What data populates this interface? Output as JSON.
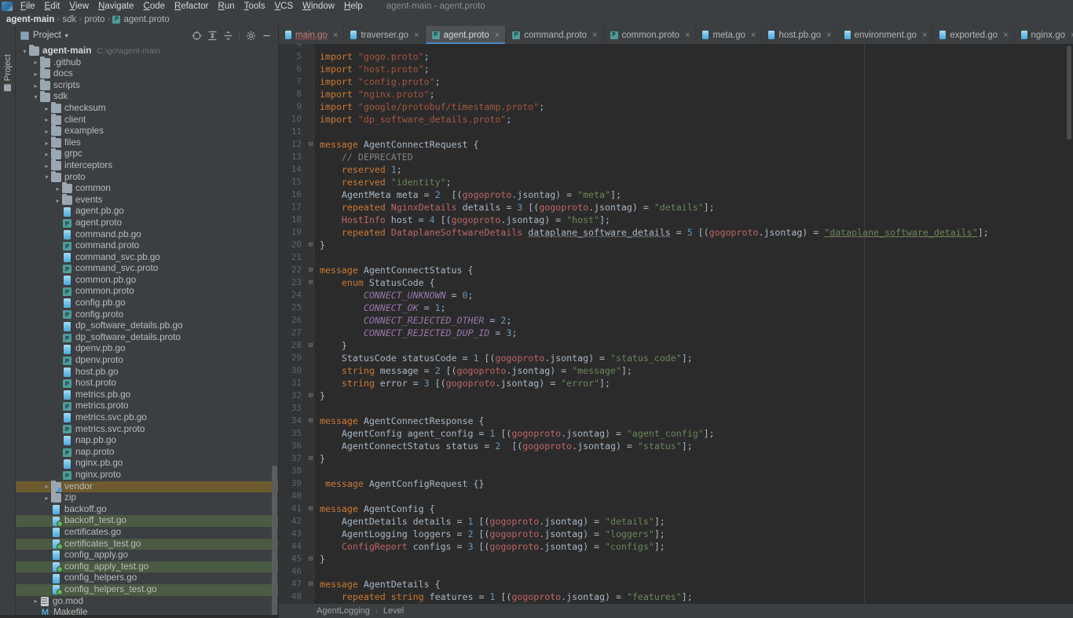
{
  "window": {
    "title": "agent-main - agent.proto",
    "app_icon": "intellij-idea-icon"
  },
  "menubar": {
    "items": [
      "File",
      "Edit",
      "View",
      "Navigate",
      "Code",
      "Refactor",
      "Run",
      "Tools",
      "VCS",
      "Window",
      "Help"
    ]
  },
  "breadcrumb": {
    "items": [
      "agent-main",
      "sdk",
      "proto",
      "agent.proto"
    ],
    "separator": "›"
  },
  "toolstrip": {
    "project_label": "Project"
  },
  "project_panel": {
    "title": "Project",
    "caret": "▾",
    "tools": [
      {
        "name": "locate-icon",
        "glyph": "⊕"
      },
      {
        "name": "expand-all-icon",
        "glyph": "⨏"
      },
      {
        "name": "collapse-all-icon",
        "glyph": "⊖"
      },
      {
        "name": "gear-icon",
        "glyph": "⚙"
      },
      {
        "name": "hide-panel-icon",
        "glyph": "—"
      }
    ],
    "tree": [
      {
        "label": "agent-main",
        "sub": "C:\\go\\agent-main",
        "indent": 0,
        "arrow": "v",
        "icon": "folder",
        "bold": true,
        "hl": ""
      },
      {
        "label": ".github",
        "sub": "",
        "indent": 1,
        "arrow": ">",
        "icon": "folder",
        "bold": false,
        "hl": ""
      },
      {
        "label": "docs",
        "sub": "",
        "indent": 1,
        "arrow": ">",
        "icon": "folder",
        "bold": false,
        "hl": ""
      },
      {
        "label": "scripts",
        "sub": "",
        "indent": 1,
        "arrow": ">",
        "icon": "folder",
        "bold": false,
        "hl": ""
      },
      {
        "label": "sdk",
        "sub": "",
        "indent": 1,
        "arrow": "v",
        "icon": "folder",
        "bold": false,
        "hl": ""
      },
      {
        "label": "checksum",
        "sub": "",
        "indent": 2,
        "arrow": ">",
        "icon": "folder",
        "bold": false,
        "hl": ""
      },
      {
        "label": "client",
        "sub": "",
        "indent": 2,
        "arrow": ">",
        "icon": "folder",
        "bold": false,
        "hl": ""
      },
      {
        "label": "examples",
        "sub": "",
        "indent": 2,
        "arrow": ">",
        "icon": "folder",
        "bold": false,
        "hl": ""
      },
      {
        "label": "files",
        "sub": "",
        "indent": 2,
        "arrow": ">",
        "icon": "folder",
        "bold": false,
        "hl": ""
      },
      {
        "label": "grpc",
        "sub": "",
        "indent": 2,
        "arrow": ">",
        "icon": "folder",
        "bold": false,
        "hl": ""
      },
      {
        "label": "interceptors",
        "sub": "",
        "indent": 2,
        "arrow": ">",
        "icon": "folder",
        "bold": false,
        "hl": ""
      },
      {
        "label": "proto",
        "sub": "",
        "indent": 2,
        "arrow": "v",
        "icon": "folder",
        "bold": false,
        "hl": ""
      },
      {
        "label": "common",
        "sub": "",
        "indent": 3,
        "arrow": ">",
        "icon": "folder",
        "bold": false,
        "hl": ""
      },
      {
        "label": "events",
        "sub": "",
        "indent": 3,
        "arrow": ">",
        "icon": "folder",
        "bold": false,
        "hl": ""
      },
      {
        "label": "agent.pb.go",
        "sub": "",
        "indent": 3,
        "arrow": "",
        "icon": "go",
        "bold": false,
        "hl": ""
      },
      {
        "label": "agent.proto",
        "sub": "",
        "indent": 3,
        "arrow": "",
        "icon": "proto",
        "bold": false,
        "hl": ""
      },
      {
        "label": "command.pb.go",
        "sub": "",
        "indent": 3,
        "arrow": "",
        "icon": "go",
        "bold": false,
        "hl": ""
      },
      {
        "label": "command.proto",
        "sub": "",
        "indent": 3,
        "arrow": "",
        "icon": "proto",
        "bold": false,
        "hl": ""
      },
      {
        "label": "command_svc.pb.go",
        "sub": "",
        "indent": 3,
        "arrow": "",
        "icon": "go",
        "bold": false,
        "hl": ""
      },
      {
        "label": "command_svc.proto",
        "sub": "",
        "indent": 3,
        "arrow": "",
        "icon": "proto",
        "bold": false,
        "hl": ""
      },
      {
        "label": "common.pb.go",
        "sub": "",
        "indent": 3,
        "arrow": "",
        "icon": "go",
        "bold": false,
        "hl": ""
      },
      {
        "label": "common.proto",
        "sub": "",
        "indent": 3,
        "arrow": "",
        "icon": "proto",
        "bold": false,
        "hl": ""
      },
      {
        "label": "config.pb.go",
        "sub": "",
        "indent": 3,
        "arrow": "",
        "icon": "go",
        "bold": false,
        "hl": ""
      },
      {
        "label": "config.proto",
        "sub": "",
        "indent": 3,
        "arrow": "",
        "icon": "proto",
        "bold": false,
        "hl": ""
      },
      {
        "label": "dp_software_details.pb.go",
        "sub": "",
        "indent": 3,
        "arrow": "",
        "icon": "go",
        "bold": false,
        "hl": ""
      },
      {
        "label": "dp_software_details.proto",
        "sub": "",
        "indent": 3,
        "arrow": "",
        "icon": "proto",
        "bold": false,
        "hl": ""
      },
      {
        "label": "dpenv.pb.go",
        "sub": "",
        "indent": 3,
        "arrow": "",
        "icon": "go",
        "bold": false,
        "hl": ""
      },
      {
        "label": "dpenv.proto",
        "sub": "",
        "indent": 3,
        "arrow": "",
        "icon": "proto",
        "bold": false,
        "hl": ""
      },
      {
        "label": "host.pb.go",
        "sub": "",
        "indent": 3,
        "arrow": "",
        "icon": "go",
        "bold": false,
        "hl": ""
      },
      {
        "label": "host.proto",
        "sub": "",
        "indent": 3,
        "arrow": "",
        "icon": "proto",
        "bold": false,
        "hl": ""
      },
      {
        "label": "metrics.pb.go",
        "sub": "",
        "indent": 3,
        "arrow": "",
        "icon": "go",
        "bold": false,
        "hl": ""
      },
      {
        "label": "metrics.proto",
        "sub": "",
        "indent": 3,
        "arrow": "",
        "icon": "proto",
        "bold": false,
        "hl": ""
      },
      {
        "label": "metrics.svc.pb.go",
        "sub": "",
        "indent": 3,
        "arrow": "",
        "icon": "go",
        "bold": false,
        "hl": ""
      },
      {
        "label": "metrics.svc.proto",
        "sub": "",
        "indent": 3,
        "arrow": "",
        "icon": "proto",
        "bold": false,
        "hl": ""
      },
      {
        "label": "nap.pb.go",
        "sub": "",
        "indent": 3,
        "arrow": "",
        "icon": "go",
        "bold": false,
        "hl": ""
      },
      {
        "label": "nap.proto",
        "sub": "",
        "indent": 3,
        "arrow": "",
        "icon": "proto",
        "bold": false,
        "hl": ""
      },
      {
        "label": "nginx.pb.go",
        "sub": "",
        "indent": 3,
        "arrow": "",
        "icon": "go",
        "bold": false,
        "hl": ""
      },
      {
        "label": "nginx.proto",
        "sub": "",
        "indent": 3,
        "arrow": "",
        "icon": "proto",
        "bold": false,
        "hl": ""
      },
      {
        "label": "vendor",
        "sub": "",
        "indent": 2,
        "arrow": ">",
        "icon": "folder-mod",
        "bold": false,
        "hl": "olive"
      },
      {
        "label": "zip",
        "sub": "",
        "indent": 2,
        "arrow": ">",
        "icon": "folder",
        "bold": false,
        "hl": ""
      },
      {
        "label": "backoff.go",
        "sub": "",
        "indent": 2,
        "arrow": "",
        "icon": "go",
        "bold": false,
        "hl": ""
      },
      {
        "label": "backoff_test.go",
        "sub": "",
        "indent": 2,
        "arrow": "",
        "icon": "gotest",
        "bold": false,
        "hl": "green"
      },
      {
        "label": "certificates.go",
        "sub": "",
        "indent": 2,
        "arrow": "",
        "icon": "go",
        "bold": false,
        "hl": ""
      },
      {
        "label": "certificates_test.go",
        "sub": "",
        "indent": 2,
        "arrow": "",
        "icon": "gotest",
        "bold": false,
        "hl": "green"
      },
      {
        "label": "config_apply.go",
        "sub": "",
        "indent": 2,
        "arrow": "",
        "icon": "go",
        "bold": false,
        "hl": ""
      },
      {
        "label": "config_apply_test.go",
        "sub": "",
        "indent": 2,
        "arrow": "",
        "icon": "gotest",
        "bold": false,
        "hl": "green"
      },
      {
        "label": "config_helpers.go",
        "sub": "",
        "indent": 2,
        "arrow": "",
        "icon": "go",
        "bold": false,
        "hl": ""
      },
      {
        "label": "config_helpers_test.go",
        "sub": "",
        "indent": 2,
        "arrow": "",
        "icon": "gotest",
        "bold": false,
        "hl": "green"
      },
      {
        "label": "go.mod",
        "sub": "",
        "indent": 1,
        "arrow": ">",
        "icon": "gomod",
        "bold": false,
        "hl": ""
      },
      {
        "label": "Makefile",
        "sub": "",
        "indent": 1,
        "arrow": "",
        "icon": "makefile",
        "bold": false,
        "hl": ""
      }
    ]
  },
  "editor": {
    "tabs": [
      {
        "label": "main.go",
        "icon": "go",
        "active": false,
        "error": true
      },
      {
        "label": "traverser.go",
        "icon": "go",
        "active": false,
        "error": false
      },
      {
        "label": "agent.proto",
        "icon": "proto",
        "active": true,
        "error": false
      },
      {
        "label": "command.proto",
        "icon": "proto",
        "active": false,
        "error": false
      },
      {
        "label": "common.proto",
        "icon": "proto",
        "active": false,
        "error": false
      },
      {
        "label": "meta.go",
        "icon": "go",
        "active": false,
        "error": false
      },
      {
        "label": "host.pb.go",
        "icon": "go",
        "active": false,
        "error": false
      },
      {
        "label": "environment.go",
        "icon": "go",
        "active": false,
        "error": false
      },
      {
        "label": "exported.go",
        "icon": "go",
        "active": false,
        "error": false
      },
      {
        "label": "nginx.go",
        "icon": "go",
        "active": false,
        "error": false
      }
    ],
    "close_glyph": "×",
    "first_line_number": 4,
    "lines": [
      {
        "n": 4,
        "fold": "",
        "html": ""
      },
      {
        "n": 5,
        "fold": "",
        "html": "<span class='k'>import</span> <span class='istr'>\"gogo.proto\"</span>;"
      },
      {
        "n": 6,
        "fold": "",
        "html": "<span class='k'>import</span> <span class='istr'>\"host.proto\"</span>;"
      },
      {
        "n": 7,
        "fold": "",
        "html": "<span class='k'>import</span> <span class='istr'>\"config.proto\"</span>;"
      },
      {
        "n": 8,
        "fold": "",
        "html": "<span class='k'>import</span> <span class='istr'>\"nginx.proto\"</span>;"
      },
      {
        "n": 9,
        "fold": "",
        "html": "<span class='k'>import</span> <span class='istr'>\"google/protobuf/timestamp.proto\"</span>;"
      },
      {
        "n": 10,
        "fold": "",
        "html": "<span class='k'>import</span> <span class='istr'>\"dp_software_details.proto\"</span>;"
      },
      {
        "n": 11,
        "fold": "",
        "html": ""
      },
      {
        "n": 12,
        "fold": "-",
        "html": "<span class='k'>message</span> AgentConnectRequest {"
      },
      {
        "n": 13,
        "fold": "",
        "html": "    <span class='cmt'>// DEPRECATED</span>"
      },
      {
        "n": 14,
        "fold": "",
        "html": "    <span class='k'>reserved</span> <span class='num2'>1</span>;"
      },
      {
        "n": 15,
        "fold": "",
        "html": "    <span class='k'>reserved</span> <span class='str'>\"identity\"</span>;"
      },
      {
        "n": 16,
        "fold": "",
        "html": "    <span class='typ'>AgentMeta</span> meta = <span class='num2'>2</span>  [(<span class='optr'>gogoproto</span>.jsontag) = <span class='str'>\"meta\"</span>];"
      },
      {
        "n": 17,
        "fold": "",
        "html": "    <span class='k'>repeated</span> <span class='ctyp'>NginxDetails</span> details = <span class='num2'>3</span> [(<span class='optr'>gogoproto</span>.jsontag) = <span class='str'>\"details\"</span>];"
      },
      {
        "n": 18,
        "fold": "",
        "html": "    <span class='ctyp'>HostInfo</span> host = <span class='num2'>4</span> [(<span class='optr'>gogoproto</span>.jsontag) = <span class='str'>\"host\"</span>];"
      },
      {
        "n": 19,
        "fold": "",
        "html": "    <span class='k'>repeated</span> <span class='ctyp'>DataplaneSoftwareDetails</span> <span class='undw'>dataplane_software_details</span> = <span class='num2'>5</span> [(<span class='optr'>gogoproto</span>.jsontag) = <span class='str und'>\"dataplane_software_details\"</span>];"
      },
      {
        "n": 20,
        "fold": "-",
        "html": "}"
      },
      {
        "n": 21,
        "fold": "",
        "html": ""
      },
      {
        "n": 22,
        "fold": "-",
        "html": "<span class='k'>message</span> AgentConnectStatus {"
      },
      {
        "n": 23,
        "fold": "-",
        "html": "    <span class='k'>enum</span> StatusCode {"
      },
      {
        "n": 24,
        "fold": "",
        "html": "        <span class='en'>CONNECT_UNKNOWN</span> = <span class='num2'>0</span>;"
      },
      {
        "n": 25,
        "fold": "",
        "html": "        <span class='en'>CONNECT_OK</span> = <span class='num2'>1</span>;"
      },
      {
        "n": 26,
        "fold": "",
        "html": "        <span class='en'>CONNECT_REJECTED_OTHER</span> = <span class='num2'>2</span>;"
      },
      {
        "n": 27,
        "fold": "",
        "html": "        <span class='en'>CONNECT_REJECTED_DUP_ID</span> = <span class='num2'>3</span>;"
      },
      {
        "n": 28,
        "fold": "-",
        "html": "    }"
      },
      {
        "n": 29,
        "fold": "",
        "html": "    <span class='typ'>StatusCode</span> statusCode = <span class='num2'>1</span> [(<span class='optr'>gogoproto</span>.jsontag) = <span class='str'>\"status_code\"</span>];"
      },
      {
        "n": 30,
        "fold": "",
        "html": "    <span class='k'>string</span> message = <span class='num2'>2</span> [(<span class='optr'>gogoproto</span>.jsontag) = <span class='str'>\"message\"</span>];"
      },
      {
        "n": 31,
        "fold": "",
        "html": "    <span class='k'>string</span> error = <span class='num2'>3</span> [(<span class='optr'>gogoproto</span>.jsontag) = <span class='str'>\"error\"</span>];"
      },
      {
        "n": 32,
        "fold": "-",
        "html": "}"
      },
      {
        "n": 33,
        "fold": "",
        "html": ""
      },
      {
        "n": 34,
        "fold": "-",
        "html": "<span class='k'>message</span> AgentConnectResponse {"
      },
      {
        "n": 35,
        "fold": "",
        "html": "    <span class='typ'>AgentConfig</span> agent_config = <span class='num2'>1</span> [(<span class='optr'>gogoproto</span>.jsontag) = <span class='str'>\"agent_config\"</span>];"
      },
      {
        "n": 36,
        "fold": "",
        "html": "    <span class='typ'>AgentConnectStatus</span> status = <span class='num2'>2</span>  [(<span class='optr'>gogoproto</span>.jsontag) = <span class='str'>\"status\"</span>];"
      },
      {
        "n": 37,
        "fold": "-",
        "html": "}"
      },
      {
        "n": 38,
        "fold": "",
        "html": ""
      },
      {
        "n": 39,
        "fold": "",
        "html": " <span class='k'>message</span> AgentConfigRequest {}"
      },
      {
        "n": 40,
        "fold": "",
        "html": ""
      },
      {
        "n": 41,
        "fold": "-",
        "html": "<span class='k'>message</span> AgentConfig {"
      },
      {
        "n": 42,
        "fold": "",
        "html": "    <span class='typ'>AgentDetails</span> details = <span class='num2'>1</span> [(<span class='optr'>gogoproto</span>.jsontag) = <span class='str'>\"details\"</span>];"
      },
      {
        "n": 43,
        "fold": "",
        "html": "    <span class='typ'>AgentLogging</span> loggers = <span class='num2'>2</span> [(<span class='optr'>gogoproto</span>.jsontag) = <span class='str'>\"loggers\"</span>];"
      },
      {
        "n": 44,
        "fold": "",
        "html": "    <span class='ctyp'>ConfigReport</span> configs = <span class='num2'>3</span> [(<span class='optr'>gogoproto</span>.jsontag) = <span class='str'>\"configs\"</span>];"
      },
      {
        "n": 45,
        "fold": "-",
        "html": "}"
      },
      {
        "n": 46,
        "fold": "",
        "html": ""
      },
      {
        "n": 47,
        "fold": "-",
        "html": "<span class='k'>message</span> AgentDetails {"
      },
      {
        "n": 48,
        "fold": "",
        "html": "    <span class='k'>repeated</span> <span class='k'>string</span> features = <span class='num2'>1</span> [(<span class='optr'>gogoproto</span>.jsontag) = <span class='str'>\"features\"</span>];"
      }
    ]
  },
  "status_breadcrumb": {
    "items": [
      "AgentLogging",
      "Level"
    ],
    "separator": "›"
  },
  "colors": {
    "accent": "#4a88c7",
    "panel_bg": "#3c3f41",
    "editor_bg": "#2b2b2b",
    "gutter_bg": "#313335",
    "tab_active_bg": "#4e5254",
    "highlight_green": "#4b5a43",
    "highlight_olive": "#6e5a2e"
  }
}
